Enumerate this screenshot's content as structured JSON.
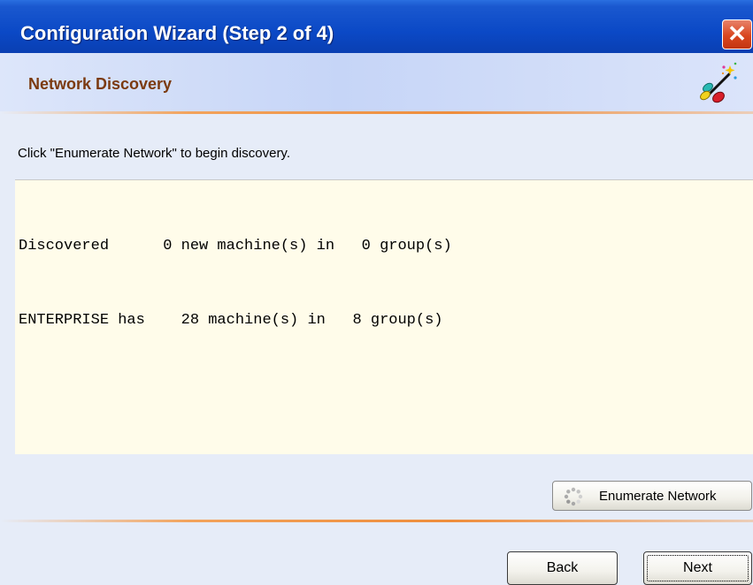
{
  "window": {
    "title": "Configuration Wizard (Step 2 of 4)",
    "close_label": "✕",
    "close_icon": "close-icon"
  },
  "header": {
    "title": "Network Discovery",
    "icon": "magic-wand-icon"
  },
  "instruction": "Click \"Enumerate Network\" to begin discovery.",
  "output": {
    "lines": [
      "Discovered      0 new machine(s) in   0 group(s)",
      "ENTERPRISE has    28 machine(s) in   8 group(s)"
    ]
  },
  "enumerate_button": {
    "label": "Enumerate Network",
    "icon": "spinner-icon"
  },
  "nav": {
    "back_label": "Back",
    "next_label": "Next"
  },
  "colors": {
    "titlebar": "#0b49c6",
    "header_text": "#7b3a10",
    "accent_rule": "#ee8d3c",
    "output_bg": "#fffcea",
    "window_bg": "#e6ecf8"
  }
}
